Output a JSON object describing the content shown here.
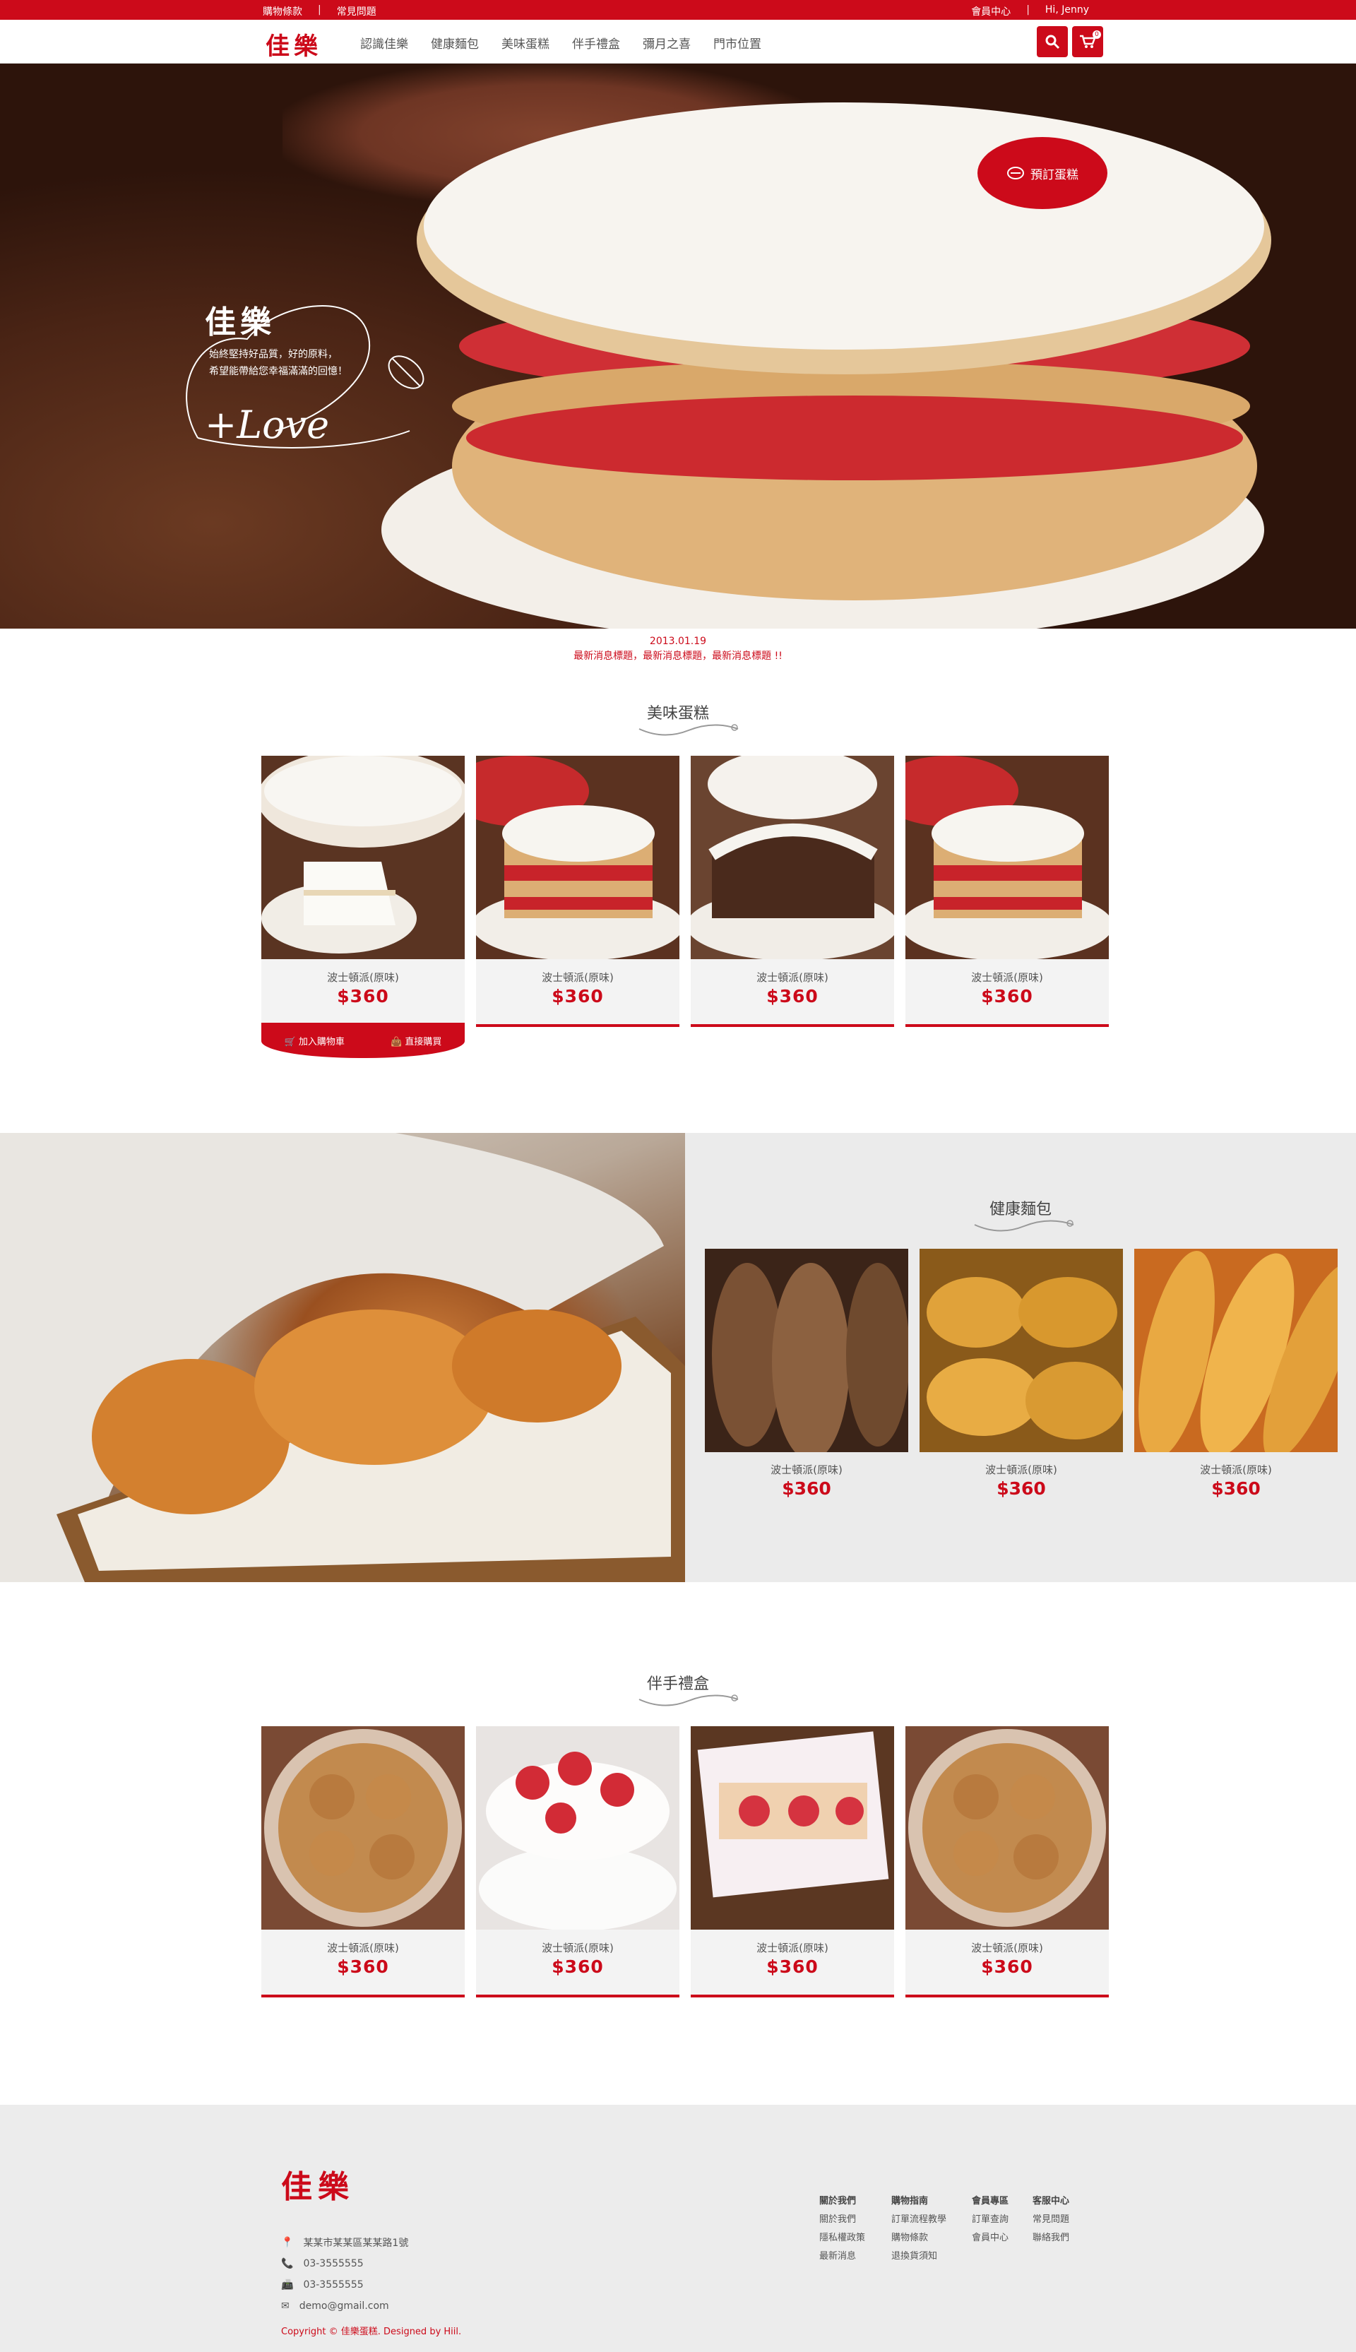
{
  "topbar": {
    "links_left": [
      "購物條款",
      "常見問題"
    ],
    "links_right": [
      "會員中心",
      "Hi, Jenny"
    ]
  },
  "brand": {
    "logo": "佳樂"
  },
  "nav": {
    "menu": [
      "認識佳樂",
      "健康麵包",
      "美味蛋糕",
      "伴手禮盒",
      "彌月之喜",
      "門市位置"
    ],
    "search_icon": "search-icon",
    "cart_icon": "cart-icon",
    "cart_count": "0"
  },
  "hero": {
    "badge_label": "預訂蛋糕",
    "brand": "佳樂",
    "tagline_1": "始終堅持好品質，好的原料，",
    "tagline_2": "希望能帶給您幸福滿滿的回憶！",
    "love": "+Love"
  },
  "news": {
    "date": "2013.01.19",
    "title": "最新消息標題，最新消息標題，最新消息標題 !!"
  },
  "sections": {
    "cakes": {
      "title": "美味蛋糕",
      "items": [
        {
          "name": "波士頓派(原味)",
          "price": "$360"
        },
        {
          "name": "波士頓派(原味)",
          "price": "$360"
        },
        {
          "name": "波士頓派(原味)",
          "price": "$360"
        },
        {
          "name": "波士頓派(原味)",
          "price": "$360"
        }
      ],
      "actions": {
        "add_to_cart": "加入購物車",
        "buy_now": "直接購買"
      }
    },
    "bread": {
      "title": "健康麵包",
      "items": [
        {
          "name": "波士頓派(原味)",
          "price": "$360"
        },
        {
          "name": "波士頓派(原味)",
          "price": "$360"
        },
        {
          "name": "波士頓派(原味)",
          "price": "$360"
        }
      ]
    },
    "gifts": {
      "title": "伴手禮盒",
      "items": [
        {
          "name": "波士頓派(原味)",
          "price": "$360"
        },
        {
          "name": "波士頓派(原味)",
          "price": "$360"
        },
        {
          "name": "波士頓派(原味)",
          "price": "$360"
        },
        {
          "name": "波士頓派(原味)",
          "price": "$360"
        }
      ]
    }
  },
  "footer": {
    "logo": "佳樂",
    "address": "某某市某某區某某路1號",
    "phone": "03-3555555",
    "fax": "03-3555555",
    "email": "demo@gmail.com",
    "copyright": "Copyright © 佳樂蛋糕. Designed by Hiil.",
    "columns": [
      {
        "heading": "關於我們",
        "links": [
          "關於我們",
          "隱私權政策",
          "最新消息"
        ]
      },
      {
        "heading": "購物指南",
        "links": [
          "訂單流程教學",
          "購物條款",
          "退換貨須知"
        ]
      },
      {
        "heading": "會員專區",
        "links": [
          "訂單查詢",
          "會員中心"
        ]
      },
      {
        "heading": "客服中心",
        "links": [
          "常見問題",
          "聯絡我們"
        ]
      }
    ]
  },
  "colors": {
    "accent": "#cc0a1a"
  }
}
